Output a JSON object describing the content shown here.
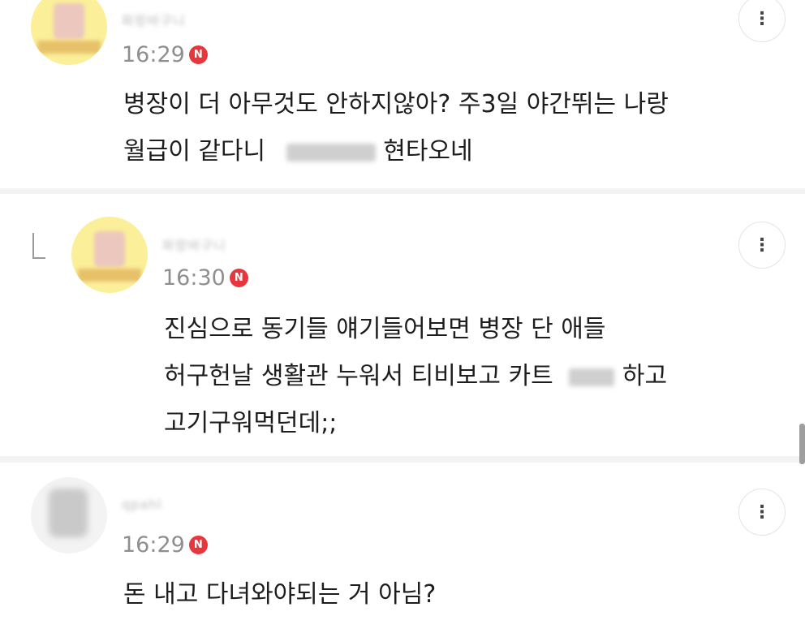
{
  "comments": [
    {
      "author": "파랑바구니",
      "time": "16:29",
      "badge": "N",
      "line1": "병장이 더 아무것도 안하지않아? 주3일 야간뛰는 나랑",
      "line2_start": "월급이 같다니",
      "line2_end": "현타오네",
      "menu_icon": "kebab-icon"
    },
    {
      "author": "파랑바구니",
      "time": "16:30",
      "badge": "N",
      "line1": "진심으로 동기들 얘기들어보면 병장 단 애들",
      "line2_start": "허구헌날 생활관 누워서 티비보고 카트",
      "line2_end": "하고",
      "line3": "고기구워먹던데;;",
      "menu_icon": "kebab-icon",
      "reply_icon": "reply-arrow-icon"
    },
    {
      "author": "qpahl",
      "time": "16:29",
      "badge": "N",
      "line1": "돈 내고 다녀와야되는 거 아님?",
      "menu_icon": "kebab-icon"
    }
  ],
  "colors": {
    "badge": "#e7363c",
    "avatar_yellow": "#fbef9a",
    "separator": "#f3f3f3"
  }
}
